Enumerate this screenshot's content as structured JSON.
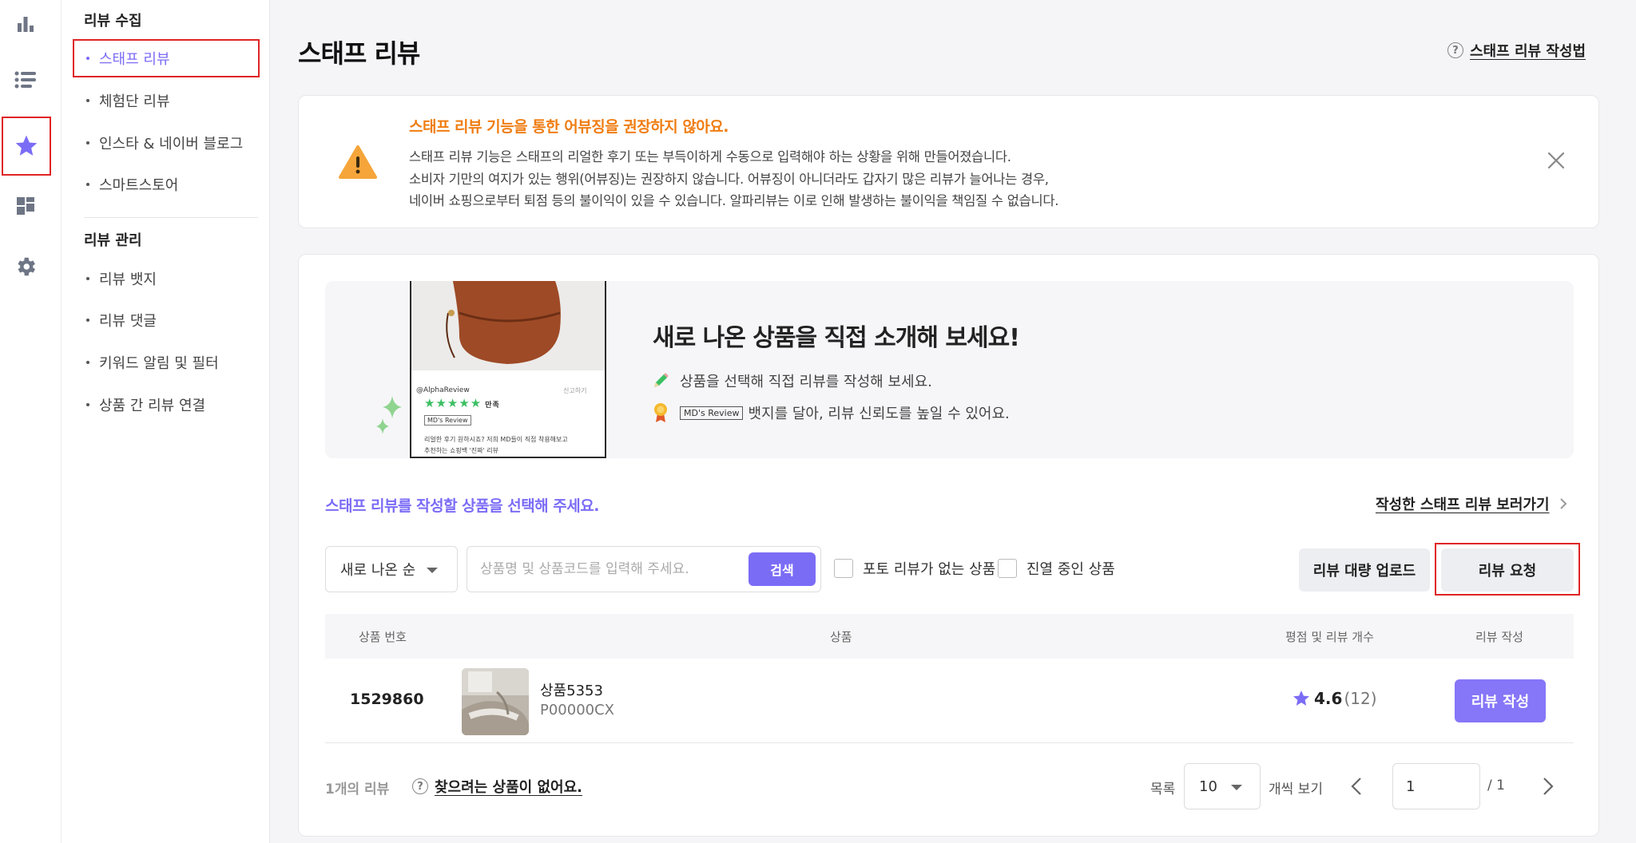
{
  "rail": {
    "items": [
      "chart-icon",
      "list-icon",
      "star-icon",
      "dashboard-icon",
      "gear-icon"
    ],
    "accent": "#7b6cf6"
  },
  "sidebar": {
    "section1": {
      "title": "리뷰 수집",
      "items": [
        {
          "label": "스태프 리뷰"
        },
        {
          "label": "체험단 리뷰"
        },
        {
          "label": "인스타 & 네이버 블로그"
        },
        {
          "label": "스마트스토어"
        }
      ]
    },
    "section2": {
      "title": "리뷰 관리",
      "items": [
        {
          "label": "리뷰 뱃지"
        },
        {
          "label": "리뷰 댓글"
        },
        {
          "label": "키워드 알림 및 필터"
        },
        {
          "label": "상품 간 리뷰 연결"
        }
      ]
    }
  },
  "header": {
    "title": "스태프 리뷰",
    "guide_link": "스태프 리뷰 작성법"
  },
  "notice": {
    "title": "스태프 리뷰 기능을 통한 어뷰징을 권장하지 않아요.",
    "lines": [
      "스태프 리뷰 기능은 스태프의 리얼한 후기 또는 부득이하게 수동으로 입력해야 하는 상황을 위해 만들어졌습니다.",
      "소비자 기만의 여지가 있는 행위(어뷰징)는 권장하지 않습니다. 어뷰징이 아니더라도 갑자기 많은 리뷰가 늘어나는 경우,",
      "네이버 쇼핑으로부터 퇴점 등의 불이익이 있을 수 있습니다. 알파리뷰는 이로 인해 발생하는 불이익을 책임질 수 없습니다."
    ]
  },
  "banner": {
    "title": "새로 나온 상품을 직접 소개해 보세요!",
    "line1": "상품을 선택해 직접 리뷰를 작성해 보세요.",
    "badge": "MD's Review",
    "line2": "뱃지를 달아, 리뷰 신뢰도를 높일 수 있어요.",
    "phone": {
      "handle": "@AlphaReview",
      "tag": "신고하기",
      "stars": "★★★★★",
      "satisfaction": "만족",
      "badge": "MD's Review",
      "text1": "리얼한 후기 원하시죠? 저희 MD들이 직접 착용해보고",
      "text2": "추천하는 쇼핑백 '진짜' 리뷰"
    }
  },
  "list": {
    "prompt": "스태프 리뷰를 작성할 상품을 선택해 주세요.",
    "written_link": "작성한 스태프 리뷰 보러가기",
    "sort_value": "새로 나온 순",
    "search_placeholder": "상품명 및 상품코드를 입력해 주세요.",
    "search_button": "검색",
    "filter_no_photo": "포토 리뷰가 없는 상품",
    "filter_displayed": "진열 중인 상품",
    "bulk_upload": "리뷰 대량 업로드",
    "request": "리뷰 요청",
    "columns": [
      "상품 번호",
      "상품",
      "평점 및 리뷰 개수",
      "리뷰 작성"
    ],
    "rows": [
      {
        "no": "1529860",
        "name": "상품5353",
        "code": "P00000CX",
        "rating": "4.6",
        "count": "(12)",
        "action": "리뷰 작성"
      }
    ]
  },
  "footer": {
    "total": "1개의 리뷰",
    "not_found": "찾으려는 상품이 없어요.",
    "per_page_label": "목록",
    "per_page_value": "10",
    "per_page_suffix": "개씩 보기",
    "page_value": "1",
    "page_total": "/ 1"
  }
}
